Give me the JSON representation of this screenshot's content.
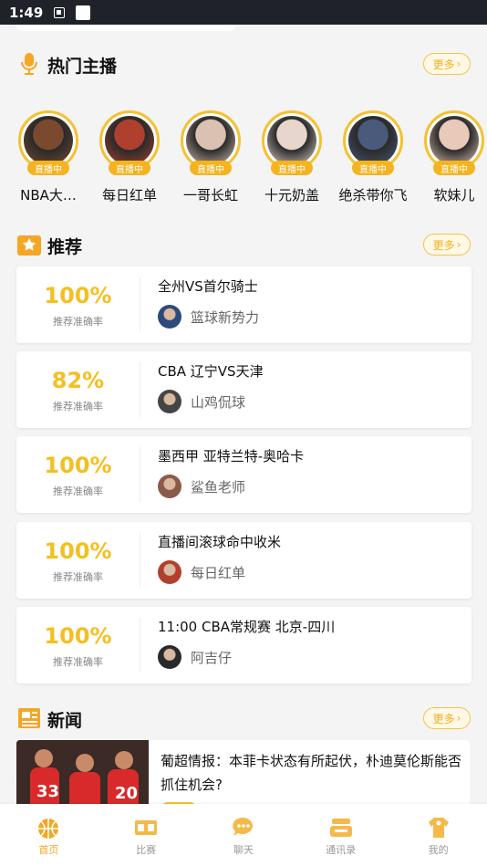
{
  "status_bar": {
    "time": "1:49"
  },
  "hot_streamers": {
    "title": "热门主播",
    "more_label": "更多",
    "live_label": "直播中",
    "items": [
      {
        "name": "NBA大…",
        "color": "#7b4a2e"
      },
      {
        "name": "每日红单",
        "color": "#b0402e"
      },
      {
        "name": "一哥长虹",
        "color": "#d9c2b1"
      },
      {
        "name": "十元奶盖",
        "color": "#e6d6cc"
      },
      {
        "name": "绝杀带你飞",
        "color": "#4a5a7a"
      },
      {
        "name": "软妹儿",
        "color": "#e9c9b9"
      }
    ]
  },
  "recommend": {
    "title": "推荐",
    "more_label": "更多",
    "rate_label": "推荐准确率",
    "items": [
      {
        "rate": "100%",
        "match": "全州VS首尔骑士",
        "author": "篮球新势力",
        "avatar_color": "#2d4a7a"
      },
      {
        "rate": "82%",
        "match": "CBA 辽宁VS天津",
        "author": "山鸡侃球",
        "avatar_color": "#444444"
      },
      {
        "rate": "100%",
        "match": "墨西甲 亚特兰特-奥哈卡",
        "author": "鲨鱼老师",
        "avatar_color": "#8a5a4a"
      },
      {
        "rate": "100%",
        "match": "直播间滚球命中收米",
        "author": "每日红单",
        "avatar_color": "#b0402e"
      },
      {
        "rate": "100%",
        "match": "11:00 CBA常规赛 北京-四川",
        "author": "阿吉仔",
        "avatar_color": "#2a2a2a"
      }
    ]
  },
  "news": {
    "title": "新闻",
    "more_label": "更多",
    "headline": "葡超情报：本菲卡状态有所起伏，朴迪莫伦斯能否抓住机会?"
  },
  "tabbar": {
    "items": [
      {
        "label": "首页",
        "active": true
      },
      {
        "label": "比赛",
        "active": false
      },
      {
        "label": "聊天",
        "active": false
      },
      {
        "label": "通讯录",
        "active": false
      },
      {
        "label": "我的",
        "active": false
      }
    ]
  },
  "colors": {
    "accent": "#f5bf20",
    "tab_active": "#f5a623"
  }
}
